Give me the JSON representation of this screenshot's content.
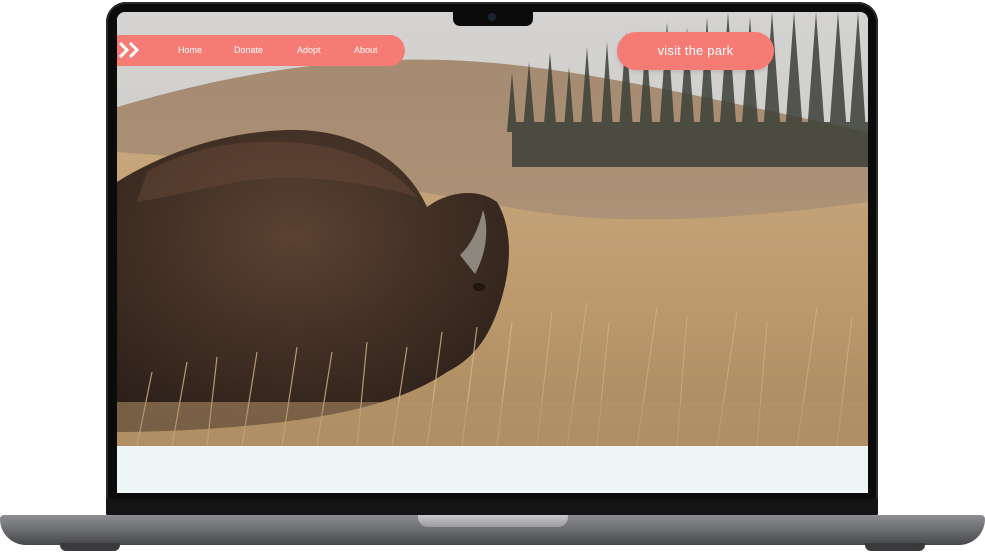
{
  "nav": {
    "items": [
      {
        "label": "Home"
      },
      {
        "label": "Donate"
      },
      {
        "label": "Adopt"
      },
      {
        "label": "About"
      }
    ]
  },
  "cta": {
    "label": "visit the park"
  },
  "colors": {
    "accent": "#f67b75",
    "below_hero_background": "#eef5f7",
    "device_frame": "#0b0b0c"
  },
  "icons": {
    "logo": "double-chevron-right-icon",
    "camera": "camera-dot"
  }
}
